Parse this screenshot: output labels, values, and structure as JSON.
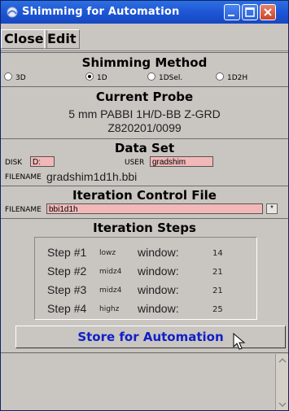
{
  "window": {
    "title": "Shimming for Automation"
  },
  "menu": {
    "close": "Close",
    "edit": "Edit"
  },
  "shim_method": {
    "title": "Shimming Method",
    "options": [
      "3D",
      "1D",
      "1DSel.",
      "1D2H"
    ],
    "selected": "1D"
  },
  "probe": {
    "title": "Current Probe",
    "line1": "5 mm PABBI 1H/D-BB Z-GRD",
    "line2": "Z820201/0099"
  },
  "dataset": {
    "title": "Data Set",
    "disk_label": "DISK",
    "disk_value": "D:",
    "user_label": "USER",
    "user_value": "gradshim",
    "filename_label": "FILENAME",
    "filename_value": "gradshim1d1h.bbi"
  },
  "iteration_control": {
    "title": "Iteration Control File",
    "filename_label": "FILENAME",
    "filename_value": "bbi1d1h",
    "browse": "*"
  },
  "iteration_steps": {
    "title": "Iteration Steps",
    "window_label": "window:",
    "steps": [
      {
        "label": "Step #1",
        "kind": "lowz",
        "window": "14"
      },
      {
        "label": "Step #2",
        "kind": "midz4",
        "window": "21"
      },
      {
        "label": "Step #3",
        "kind": "midz4",
        "window": "21"
      },
      {
        "label": "Step #4",
        "kind": "highz",
        "window": "25"
      }
    ]
  },
  "store_button": "Store for Automation",
  "colors": {
    "titlebar": "#1d56d6",
    "field": "#f2b8b8",
    "button_text": "#1020c8",
    "panel": "#c9c5c0"
  }
}
